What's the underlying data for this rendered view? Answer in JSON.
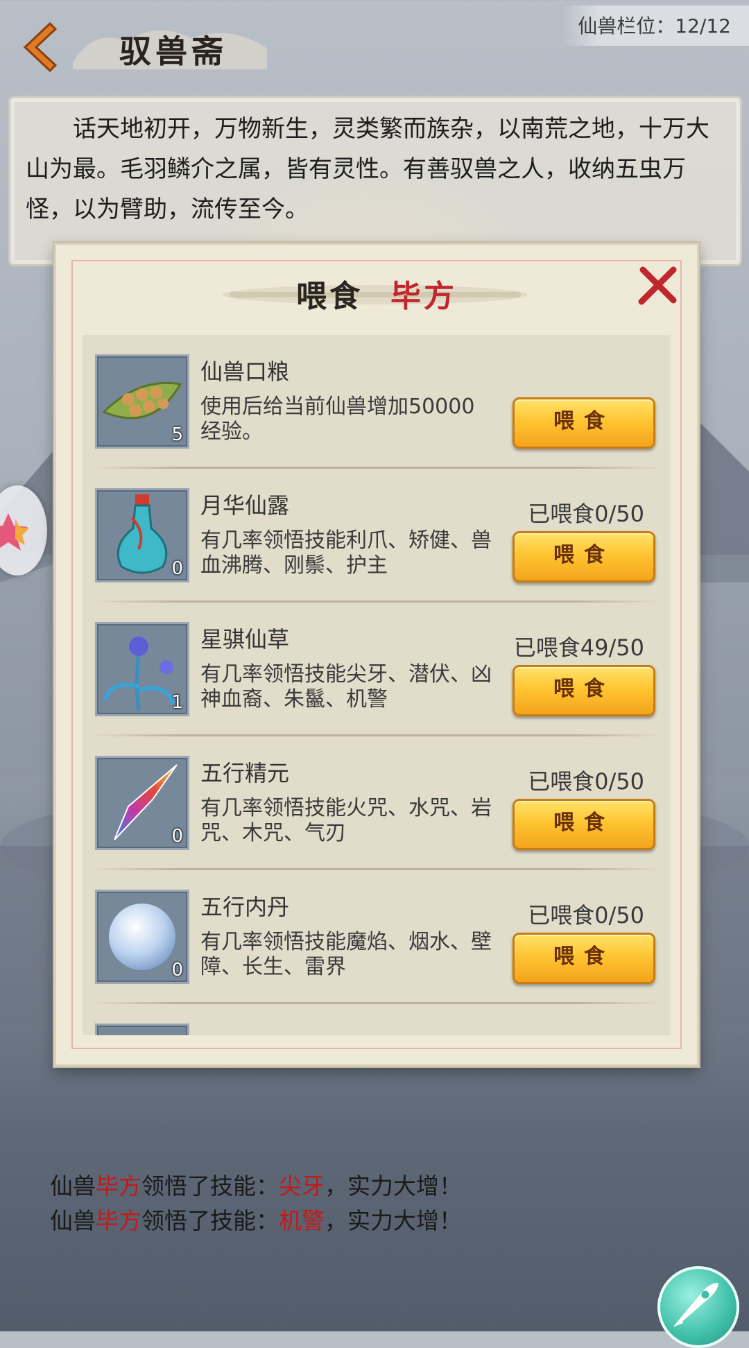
{
  "header": {
    "back_icon": "arrow-left-icon",
    "title": "驭兽斋",
    "slots_label": "仙兽栏位：12/12"
  },
  "intro": {
    "text": "话天地初开，万物新生，灵类繁而族杂，以南荒之地，十万大山为最。毛羽鳞介之属，皆有灵性。有善驭兽之人，收纳五虫万怪，以为臂助，流传至今。"
  },
  "modal": {
    "title_action": "喂食",
    "title_pet": "毕方",
    "close_icon": "close-x-icon",
    "items": [
      {
        "name": "仙兽口粮",
        "desc": "使用后给当前仙兽增加50000经验。",
        "count": "5",
        "fed": "",
        "button": "喂食",
        "icon": "seed-pod-icon"
      },
      {
        "name": "月华仙露",
        "desc": "有几率领悟技能利爪、矫健、兽血沸腾、刚鬃、护主",
        "count": "0",
        "fed": "已喂食0/50",
        "button": "喂食",
        "icon": "blue-vase-icon"
      },
      {
        "name": "星骐仙草",
        "desc": "有几率领悟技能尖牙、潜伏、凶神血裔、朱鬣、机警",
        "count": "1",
        "fed": "已喂食49/50",
        "button": "喂食",
        "icon": "blue-flower-icon"
      },
      {
        "name": "五行精元",
        "desc": "有几率领悟技能火咒、水咒、岩咒、木咒、气刃",
        "count": "0",
        "fed": "已喂食0/50",
        "button": "喂食",
        "icon": "crystal-icon"
      },
      {
        "name": "五行内丹",
        "desc": "有几率领悟技能魔焰、烟水、壁障、长生、雷界",
        "count": "0",
        "fed": "已喂食0/50",
        "button": "喂食",
        "icon": "pearl-icon"
      }
    ]
  },
  "logs": [
    {
      "prefix": "仙兽",
      "pet": "毕方",
      "mid": "领悟了技能：",
      "skill": "尖牙",
      "suffix": "，实力大增！"
    },
    {
      "prefix": "仙兽",
      "pet": "毕方",
      "mid": "领悟了技能：",
      "skill": "机警",
      "suffix": "，实力大增！"
    }
  ],
  "side": {
    "star_icon": "star-icon",
    "rocket_icon": "rocket-icon"
  },
  "colors": {
    "accent_red": "#c0272d",
    "button_gold": "#ffc533",
    "panel_bg": "#efe9d8"
  }
}
